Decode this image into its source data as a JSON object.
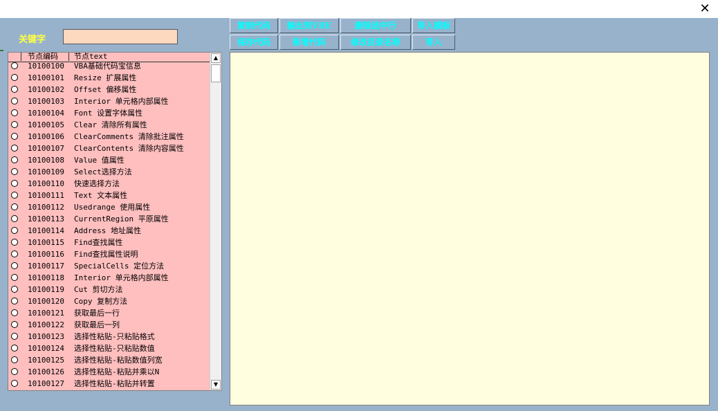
{
  "window": {
    "close_glyph": "✕"
  },
  "search": {
    "label": "关键字",
    "value": ""
  },
  "toolbar": {
    "row1": [
      "复制代码",
      "输出到VBE",
      "删除选中行",
      "导入模板"
    ],
    "row2": [
      "保存代码",
      "新增代码",
      "修改目录名称",
      "导入"
    ]
  },
  "list": {
    "headers": {
      "code": "节点编码",
      "text": "节点text"
    },
    "items": [
      {
        "code": "10100100",
        "text": "VBA基础代码宝信息"
      },
      {
        "code": "10100101",
        "text": "Resize 扩展属性"
      },
      {
        "code": "10100102",
        "text": "Offset 偏移属性"
      },
      {
        "code": "10100103",
        "text": "Interior 单元格内部属性"
      },
      {
        "code": "10100104",
        "text": "Font 设置字体属性"
      },
      {
        "code": "10100105",
        "text": "Clear 清除所有属性"
      },
      {
        "code": "10100106",
        "text": "ClearComments 清除批注属性"
      },
      {
        "code": "10100107",
        "text": "ClearContents 清除内容属性"
      },
      {
        "code": "10100108",
        "text": "Value 值属性"
      },
      {
        "code": "10100109",
        "text": "Select选择方法"
      },
      {
        "code": "10100110",
        "text": "快速选择方法"
      },
      {
        "code": "10100111",
        "text": "Text 文本属性"
      },
      {
        "code": "10100112",
        "text": "Usedrange 使用属性"
      },
      {
        "code": "10100113",
        "text": "CurrentRegion 平原属性"
      },
      {
        "code": "10100114",
        "text": "Address 地址属性"
      },
      {
        "code": "10100115",
        "text": "Find查找属性"
      },
      {
        "code": "10100116",
        "text": "Find查找属性说明"
      },
      {
        "code": "10100117",
        "text": "SpecialCells 定位方法"
      },
      {
        "code": "10100118",
        "text": "Interior 单元格内部属性"
      },
      {
        "code": "10100119",
        "text": "Cut 剪切方法"
      },
      {
        "code": "10100120",
        "text": "Copy 复制方法"
      },
      {
        "code": "10100121",
        "text": "获取最后一行"
      },
      {
        "code": "10100122",
        "text": "获取最后一列"
      },
      {
        "code": "10100123",
        "text": "选择性粘贴-只粘贴格式"
      },
      {
        "code": "10100124",
        "text": "选择性粘贴-只粘贴数值"
      },
      {
        "code": "10100125",
        "text": "选择性粘贴-粘贴数值列宽"
      },
      {
        "code": "10100126",
        "text": "选择性粘贴-粘贴并乘以N"
      },
      {
        "code": "10100127",
        "text": "选择性粘贴-粘贴并转置"
      }
    ]
  },
  "scroll": {
    "up_glyph": "▲",
    "down_glyph": "▼"
  },
  "editor": {
    "value": ""
  },
  "colors": {
    "frame": "#98b2cc",
    "list_bg": "#ffbfbf",
    "editor_bg": "#ffffe0",
    "button_text": "#00ffff",
    "label_text": "#ffff40"
  }
}
